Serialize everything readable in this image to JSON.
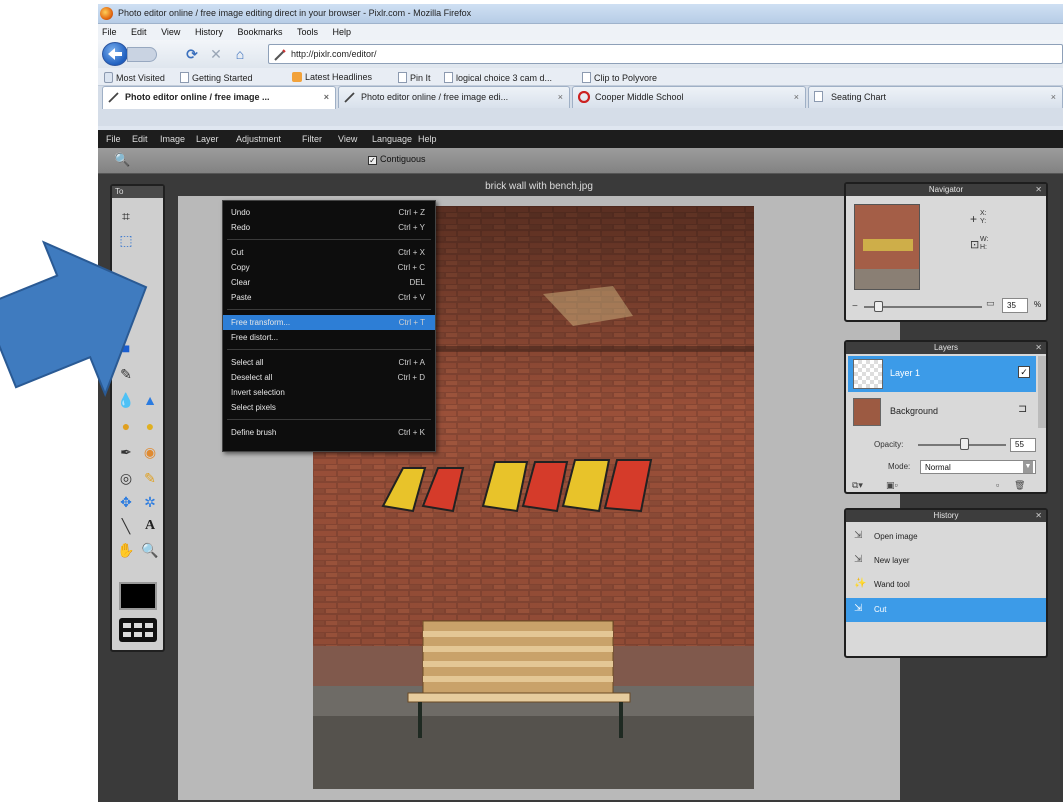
{
  "browser": {
    "title": "Photo editor online / free image editing direct in your browser - Pixlr.com - Mozilla Firefox",
    "menu": [
      "File",
      "Edit",
      "View",
      "History",
      "Bookmarks",
      "Tools",
      "Help"
    ],
    "url": "http://pixlr.com/editor/",
    "bookmarks": [
      "Most Visited",
      "Getting Started",
      "Latest Headlines",
      "Pin It",
      "logical choice 3 cam d...",
      "Clip to Polyvore"
    ],
    "tabs": [
      {
        "label": "Photo editor online / free image ...",
        "active": true
      },
      {
        "label": "Photo editor online / free image edi...",
        "active": false
      },
      {
        "label": "Cooper Middle School",
        "active": false
      },
      {
        "label": "Seating Chart",
        "active": false
      }
    ]
  },
  "app": {
    "menu": [
      "File",
      "Edit",
      "Image",
      "Layer",
      "Adjustment",
      "Filter",
      "View",
      "Language",
      "Help"
    ],
    "options": {
      "contiguous_label": "Contiguous",
      "contiguous_checked": true
    },
    "document_title": "brick wall with bench.jpg",
    "edit_menu": [
      {
        "label": "Undo",
        "shortcut": "Ctrl + Z"
      },
      {
        "label": "Redo",
        "shortcut": "Ctrl + Y"
      },
      {
        "label": "Cut",
        "shortcut": "Ctrl + X"
      },
      {
        "label": "Copy",
        "shortcut": "Ctrl + C"
      },
      {
        "label": "Clear",
        "shortcut": "DEL"
      },
      {
        "label": "Paste",
        "shortcut": "Ctrl + V"
      },
      {
        "label": "Free transform...",
        "shortcut": "Ctrl + T",
        "selected": true
      },
      {
        "label": "Free distort...",
        "shortcut": ""
      },
      {
        "label": "Select all",
        "shortcut": "Ctrl + A"
      },
      {
        "label": "Deselect all",
        "shortcut": "Ctrl + D"
      },
      {
        "label": "Invert selection",
        "shortcut": ""
      },
      {
        "label": "Select pixels",
        "shortcut": ""
      },
      {
        "label": "Define brush",
        "shortcut": "Ctrl + K"
      }
    ],
    "navigator": {
      "title": "Navigator",
      "x_label": "X:",
      "y_label": "Y:",
      "w_label": "W:",
      "h_label": "H:",
      "zoom": "35",
      "zoom_unit": "%"
    },
    "layers": {
      "title": "Layers",
      "items": [
        {
          "name": "Layer 1",
          "selected": true
        },
        {
          "name": "Background",
          "selected": false
        }
      ],
      "opacity_label": "Opacity:",
      "opacity_value": "55",
      "mode_label": "Mode:",
      "mode_value": "Normal"
    },
    "history": {
      "title": "History",
      "items": [
        {
          "label": "Open image",
          "selected": false
        },
        {
          "label": "New layer",
          "selected": false
        },
        {
          "label": "Wand tool",
          "selected": false
        },
        {
          "label": "Cut",
          "selected": true
        }
      ]
    },
    "toolbox_title": "To"
  },
  "colors": {
    "menu_highlight": "#2d7ed6",
    "panel_select": "#3c9be8",
    "arrow": "#3f7bbf",
    "foreground_swatch": "#000000"
  }
}
